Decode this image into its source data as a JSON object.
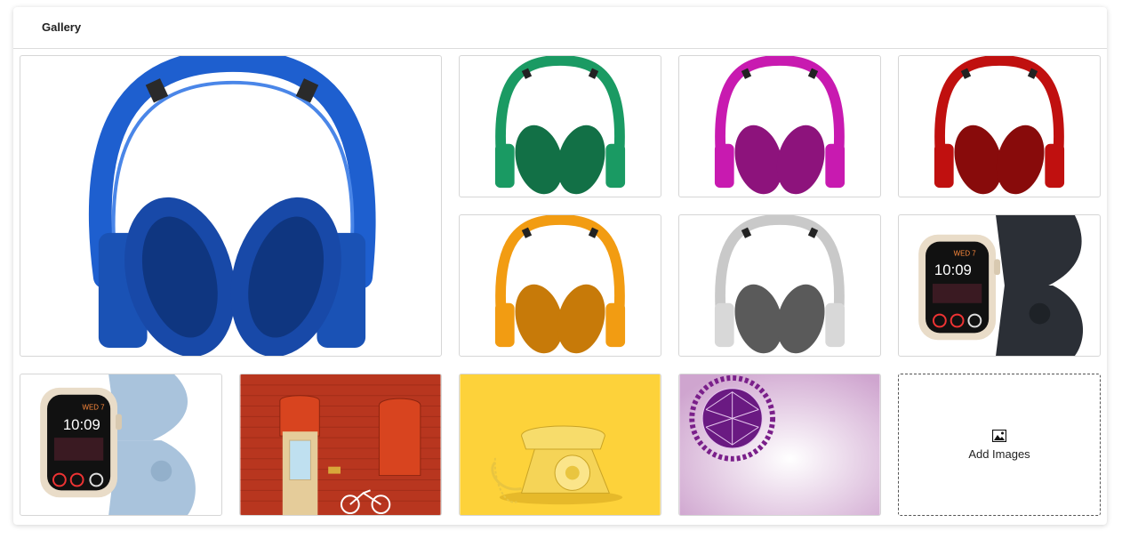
{
  "gallery": {
    "title": "Gallery",
    "add_label": "Add Images",
    "items": [
      {
        "name": "blue-headphones-image",
        "color": "#1e5fcf",
        "dark": "#16449a"
      },
      {
        "name": "green-headphones-image",
        "color": "#1a9a63",
        "dark": "#127046"
      },
      {
        "name": "magenta-headphones-image",
        "color": "#c81ab0",
        "dark": "#8d137c"
      },
      {
        "name": "red-headphones-image",
        "color": "#c0100f",
        "dark": "#880b0b"
      },
      {
        "name": "orange-headphones-image",
        "color": "#f29c12",
        "dark": "#c77a09"
      },
      {
        "name": "silver-headphones-image",
        "color": "#c9c9c9",
        "dark": "#5a5a5a"
      },
      {
        "name": "smartwatch-dark-band-image",
        "band": "#2b2f36",
        "time": "10:09",
        "day": "WED 7"
      },
      {
        "name": "smartwatch-light-band-image",
        "band": "#a9c3dc",
        "time": "10:09",
        "day": "WED 7"
      },
      {
        "name": "red-brick-wall-door-image"
      },
      {
        "name": "yellow-telephone-image"
      },
      {
        "name": "purple-globe-ornament-image"
      }
    ]
  }
}
